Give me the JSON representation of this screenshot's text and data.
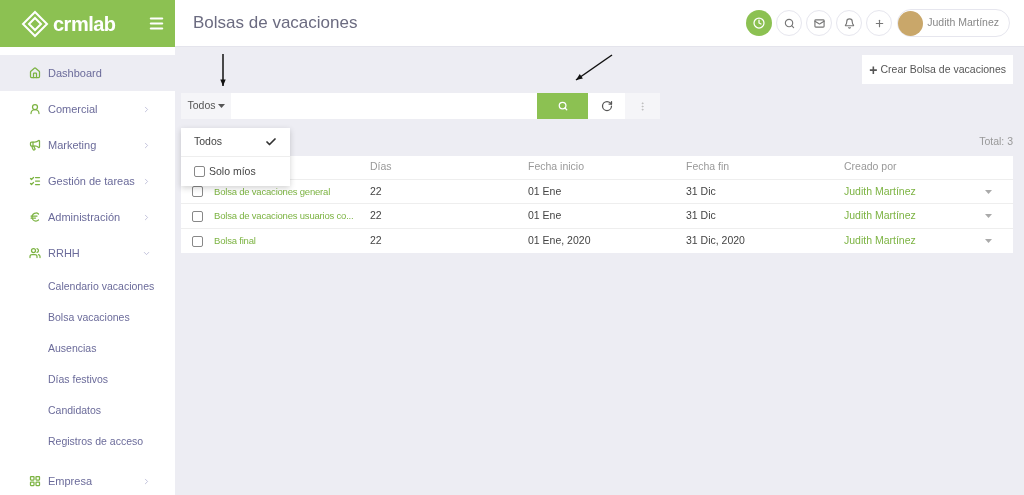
{
  "brand": {
    "name": "crmlab"
  },
  "sidebar": {
    "items": [
      {
        "label": "Dashboard",
        "selected": true
      },
      {
        "label": "Comercial",
        "selected": false,
        "expanded": false
      },
      {
        "label": "Marketing",
        "selected": false,
        "expanded": false
      },
      {
        "label": "Gestión de tareas",
        "selected": false,
        "expanded": false
      },
      {
        "label": "Administración",
        "selected": false,
        "expanded": false
      },
      {
        "label": "RRHH",
        "selected": false,
        "expanded": true,
        "children": [
          {
            "label": "Calendario vacaciones",
            "selected": false
          },
          {
            "label": "Bolsa vacaciones",
            "selected": false
          },
          {
            "label": "Ausencias",
            "selected": false
          },
          {
            "label": "Días festivos",
            "selected": false
          },
          {
            "label": "Candidatos",
            "selected": false
          },
          {
            "label": "Registros de acceso",
            "selected": false
          }
        ]
      },
      {
        "label": "Empresa",
        "selected": false,
        "expanded": false
      }
    ]
  },
  "header": {
    "title": "Bolsas de vacaciones",
    "user": {
      "name": "Judith Martínez"
    }
  },
  "create_button": {
    "icon_text": "+",
    "label": "Crear Bolsa de vacaciones"
  },
  "filter": {
    "label": "Todos",
    "expanded": true,
    "options": [
      {
        "kind": "option",
        "label": "Todos",
        "selected": true
      },
      {
        "kind": "checkbox",
        "label": "Solo míos",
        "checked": false
      }
    ]
  },
  "total": "Total: 3",
  "table": {
    "columns": [
      "Días",
      "Fecha inicio",
      "Fecha fin",
      "Creado por"
    ],
    "rows": [
      {
        "checked": false,
        "name": "Bolsa de vacaciones general",
        "dias": "22",
        "fecha_inicio": "01 Ene",
        "fecha_fin": "31 Dic",
        "creado_por": "Judith Martínez"
      },
      {
        "checked": false,
        "name": "Bolsa de vacaciones usuarios co...",
        "dias": "22",
        "fecha_inicio": "01 Ene",
        "fecha_fin": "31 Dic",
        "creado_por": "Judith Martínez"
      },
      {
        "checked": false,
        "name": "Bolsa final",
        "dias": "22",
        "fecha_inicio": "01 Ene, 2020",
        "fecha_fin": "31 Dic, 2020",
        "creado_por": "Judith Martínez"
      }
    ]
  }
}
